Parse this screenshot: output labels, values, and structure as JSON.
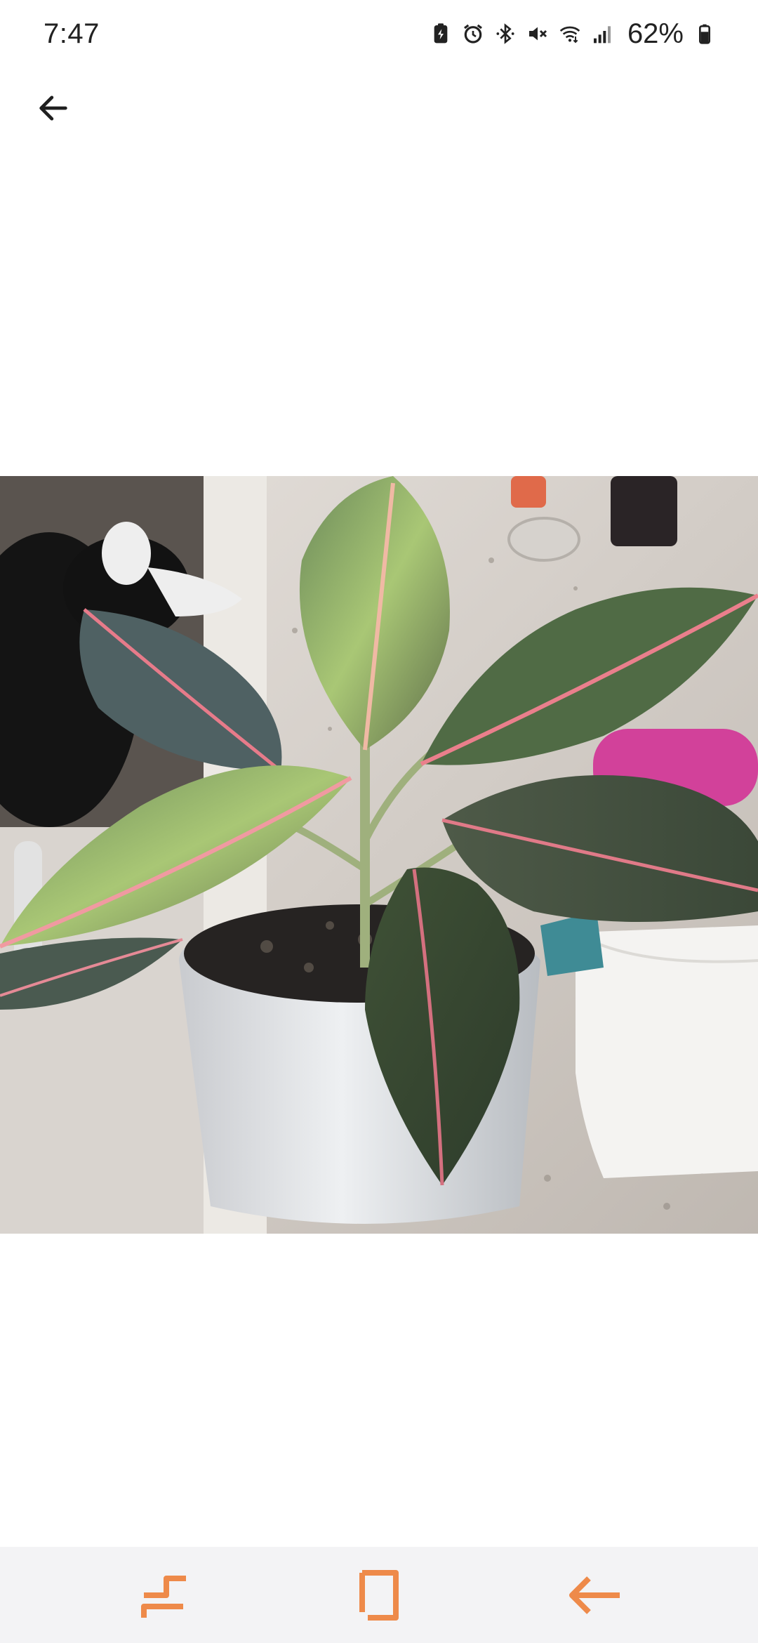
{
  "status_bar": {
    "time": "7:47",
    "battery_percent": "62%",
    "icons": [
      "battery-saver-icon",
      "alarm-icon",
      "bluetooth-icon",
      "mute-icon",
      "wifi-icon",
      "signal-icon",
      "battery-icon"
    ]
  },
  "top_bar": {
    "back_icon": "arrow-left-icon"
  },
  "photo": {
    "subject": "plant-photo"
  },
  "nav_bar": {
    "accent_color": "#ee8a4a",
    "buttons": [
      "recent-apps-icon",
      "home-icon",
      "back-icon"
    ]
  }
}
